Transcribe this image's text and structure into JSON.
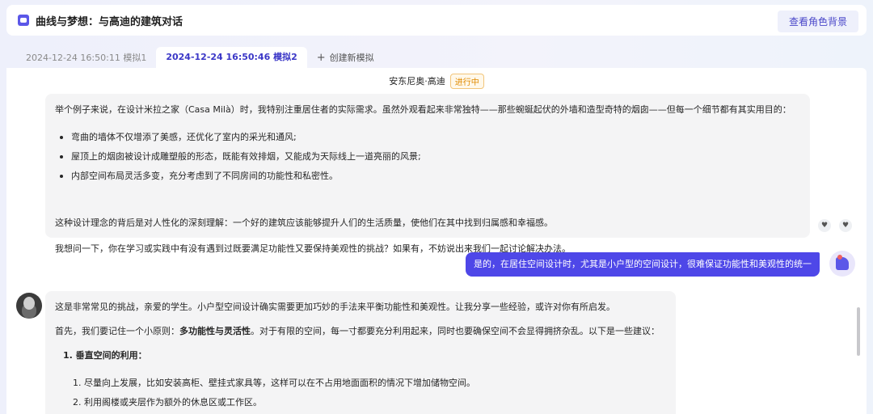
{
  "header": {
    "title": "曲线与梦想：与高迪的建筑对话",
    "background_button": "查看角色背景"
  },
  "tabs": [
    {
      "label": "2024-12-24 16:50:11 模拟1",
      "active": false
    },
    {
      "label": "2024-12-24 16:50:46 模拟2",
      "active": true
    }
  ],
  "new_tab_label": "创建新模拟",
  "character": {
    "name": "安东尼奥·高迪",
    "status": "进行中"
  },
  "messages": {
    "ai1": {
      "para1": "举个例子来说，在设计米拉之家（Casa Milà）时，我特别注重居住者的实际需求。虽然外观看起来非常独特——那些蜿蜒起伏的外墙和造型奇特的烟囱——但每一个细节都有其实用目的：",
      "bullets": [
        "弯曲的墙体不仅增添了美感，还优化了室内的采光和通风;",
        "屋顶上的烟囱被设计成雕塑般的形态，既能有效排烟，又能成为天际线上一道亮丽的风景;",
        "内部空间布局灵活多变，充分考虑到了不同房间的功能性和私密性。"
      ],
      "para2": "这种设计理念的背后是对人性化的深刻理解：一个好的建筑应该能够提升人们的生活质量，使他们在其中找到归属感和幸福感。",
      "para3": "我想问一下，你在学习或实践中有没有遇到过既要满足功能性又要保持美观性的挑战？如果有，不妨说出来我们一起讨论解决办法。"
    },
    "user1": "是的，在居住空间设计时，尤其是小户型的空间设计，很难保证功能性和美观性的统一",
    "ai2": {
      "line1": "这是非常常见的挑战，亲爱的学生。小户型空间设计确实需要更加巧妙的手法来平衡功能性和美观性。让我分享一些经验，或许对你有所启发。",
      "line2_prefix": "首先，我们要记住一个小原则：",
      "line2_bold": "多功能性与灵活性",
      "line2_suffix": "。对于有限的空间，每一寸都要充分利用起来，同时也要确保空间不会显得拥挤杂乱。以下是一些建议：",
      "list_heading": "1. 垂直空间的利用：",
      "sub1": "1. 尽量向上发展，比如安装高柜、壁挂式家具等，这样可以在不占用地面面积的情况下增加储物空间。",
      "sub2": "2. 利用阁楼或夹层作为额外的休息区或工作区。"
    }
  },
  "icons": {
    "feedback_like": "heart-icon",
    "feedback_dislike": "broken-heart-icon"
  },
  "colors": {
    "accent": "#4e47e8",
    "status": "#e08a00"
  }
}
